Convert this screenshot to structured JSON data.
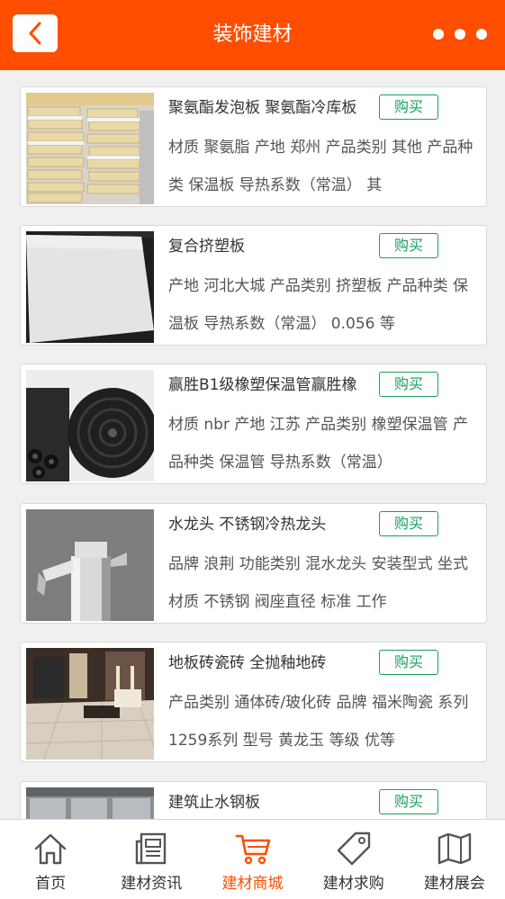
{
  "header": {
    "title": "装饰建材"
  },
  "products": [
    {
      "title": "聚氨酯发泡板 聚氨酯冷库板",
      "buy_label": "购买",
      "description": "材质 聚氨脂 产地 郑州 产品类别 其他 产品种类 保温板 导热系数（常温） 其"
    },
    {
      "title": "复合挤塑板",
      "buy_label": "购买",
      "description": "产地 河北大城 产品类别 挤塑板 产品种类 保温板 导热系数（常温） 0.056 等"
    },
    {
      "title": "赢胜B1级橡塑保温管赢胜橡",
      "buy_label": "购买",
      "description": "材质 nbr 产地 江苏 产品类别 橡塑保温管 产品种类 保温管 导热系数（常温）"
    },
    {
      "title": "水龙头 不锈钢冷热龙头",
      "buy_label": "购买",
      "description": "品牌 浪荆 功能类别 混水龙头 安装型式 坐式 材质 不锈钢 阀座直径 标准 工作"
    },
    {
      "title": "地板砖瓷砖 全抛釉地砖",
      "buy_label": "购买",
      "description": "产品类别 通体砖/玻化砖 品牌 福米陶瓷 系列 1259系列 型号 黄龙玉 等级 优等"
    },
    {
      "title": "建筑止水钢板",
      "buy_label": "购买",
      "description": ""
    }
  ],
  "tabbar": {
    "tabs": [
      {
        "label": "首页",
        "icon": "home-icon"
      },
      {
        "label": "建材资讯",
        "icon": "news-icon"
      },
      {
        "label": "建材商城",
        "icon": "cart-icon"
      },
      {
        "label": "建材求购",
        "icon": "tag-icon"
      },
      {
        "label": "建材展会",
        "icon": "map-icon"
      }
    ],
    "active_index": 2
  },
  "colors": {
    "accent": "#ff4e00",
    "buy_green": "#19a05a"
  }
}
